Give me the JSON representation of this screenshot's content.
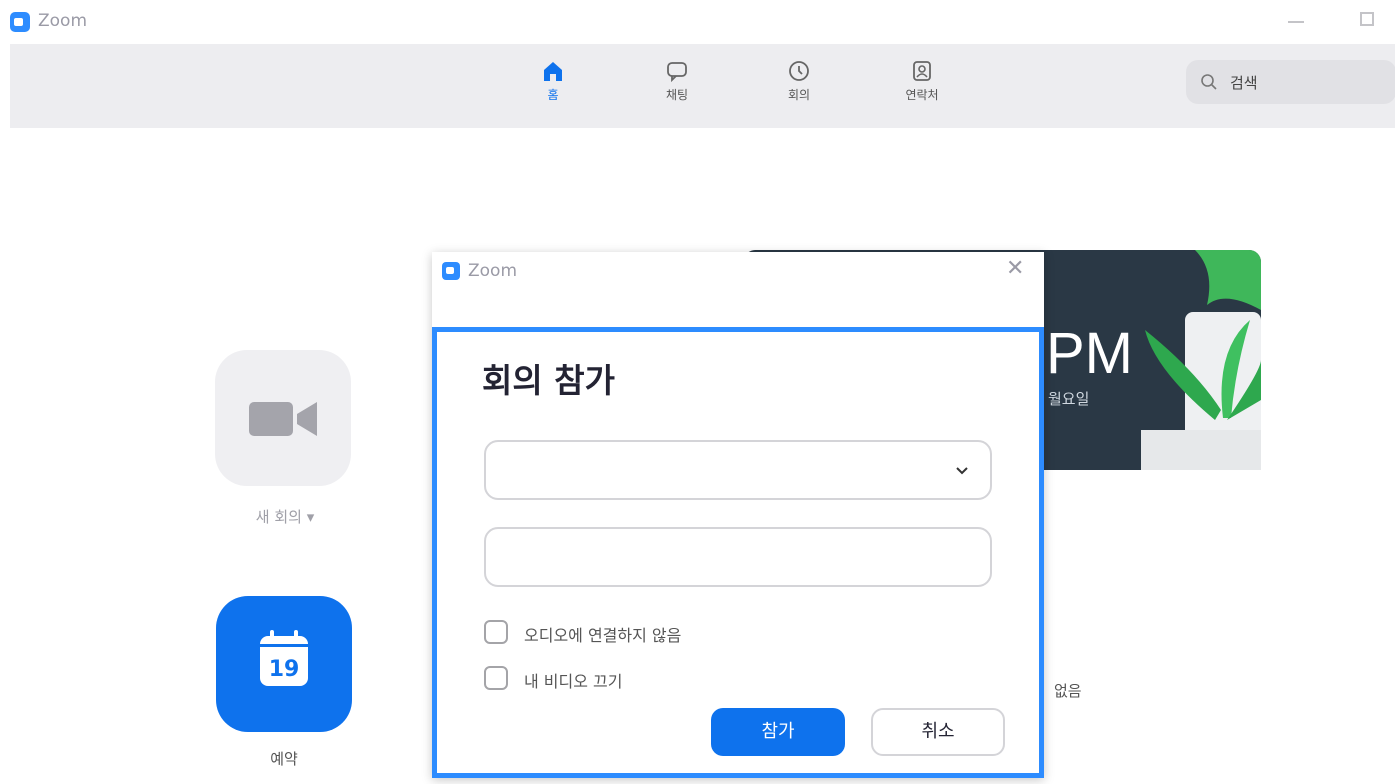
{
  "window": {
    "app_title": "Zoom"
  },
  "nav": {
    "items": [
      {
        "label": "홈",
        "icon": "home-icon",
        "active": true
      },
      {
        "label": "채팅",
        "icon": "chat-icon",
        "active": false
      },
      {
        "label": "회의",
        "icon": "clock-icon",
        "active": false
      },
      {
        "label": "연락처",
        "icon": "contacts-icon",
        "active": false
      }
    ],
    "search": {
      "placeholder": "검색"
    }
  },
  "home": {
    "new_meeting_label": "새 회의 ▾",
    "schedule_label": "예약",
    "calendar_day": "19",
    "card_time": "PM",
    "card_date": "월요일",
    "empty_text": "없음"
  },
  "dialog": {
    "title": "Zoom",
    "heading": "회의 참가",
    "meeting_id_value": "",
    "name_value": "",
    "options": [
      {
        "label": "오디오에 연결하지 않음",
        "checked": false
      },
      {
        "label": "내 비디오 끄기",
        "checked": false
      }
    ],
    "join_label": "참가",
    "cancel_label": "취소"
  },
  "colors": {
    "accent": "#0e72ed",
    "highlight_border": "#2D8CFF",
    "nav_background": "#ededf0",
    "card_background": "#2a3845"
  }
}
